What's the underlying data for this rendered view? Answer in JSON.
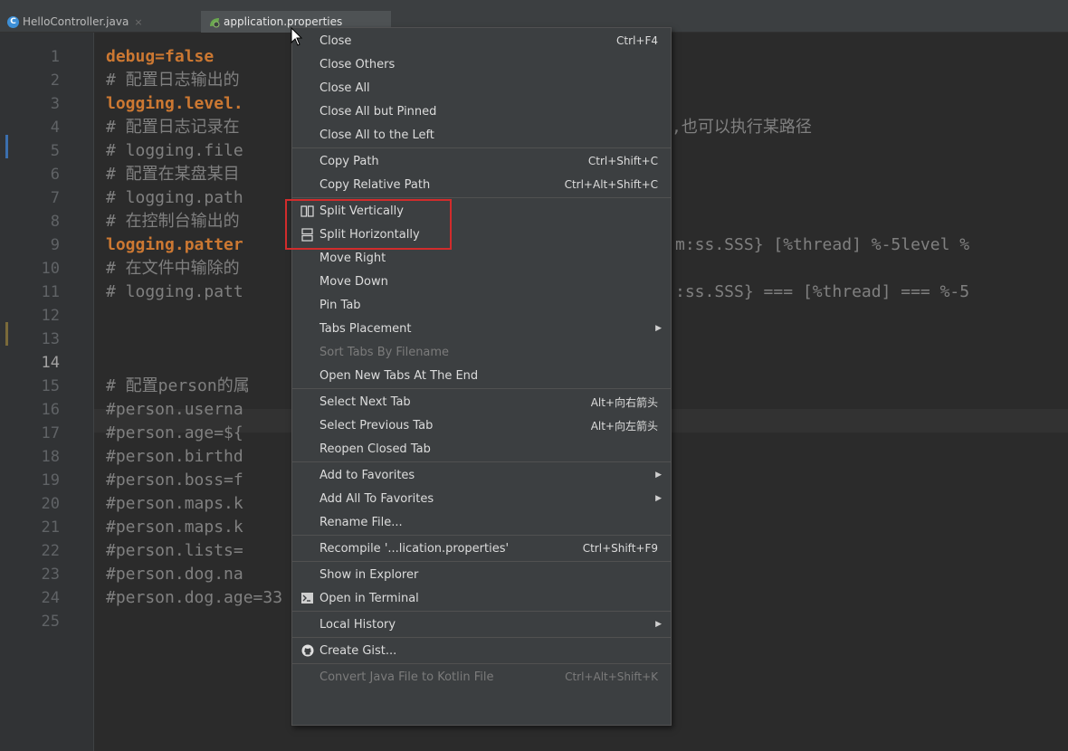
{
  "tabs": [
    {
      "name": "HelloController.java",
      "icon": "java-class-icon",
      "icon_letter": "C",
      "active": false
    },
    {
      "name": "application.properties",
      "icon": "spring-leaf-icon",
      "active": true
    }
  ],
  "editor": {
    "current_line": 14,
    "lines": [
      {
        "n": "1",
        "type": "key",
        "text": "debug=false"
      },
      {
        "n": "2",
        "type": "comment",
        "text": "# 配置日志输出的"
      },
      {
        "n": "3",
        "type": "key",
        "text": "logging.level."
      },
      {
        "n": "4",
        "type": "comment",
        "text": "# 配置日志记录在",
        "far": ",也可以执行某路径",
        "far_type": "comment"
      },
      {
        "n": "5",
        "type": "comment",
        "text": "# logging.file"
      },
      {
        "n": "6",
        "type": "comment",
        "text": "# 配置在某盘某目"
      },
      {
        "n": "7",
        "type": "comment",
        "text": "# logging.path"
      },
      {
        "n": "8",
        "type": "comment",
        "text": "# 在控制台输出的"
      },
      {
        "n": "9",
        "type": "key",
        "text": "logging.patter",
        "far": "m:ss.SSS} [%thread] %-5level %",
        "far_type": "comment"
      },
      {
        "n": "10",
        "type": "comment",
        "text": "# 在文件中输除的"
      },
      {
        "n": "11",
        "type": "comment",
        "text": "# logging.patt",
        "far": ":ss.SSS} === [%thread] === %-5",
        "far_type": "comment"
      },
      {
        "n": "12",
        "type": "comment",
        "text": ""
      },
      {
        "n": "13",
        "type": "comment",
        "text": ""
      },
      {
        "n": "14",
        "type": "comment",
        "text": ""
      },
      {
        "n": "15",
        "type": "comment",
        "text": "# 配置person的属"
      },
      {
        "n": "16",
        "type": "comment",
        "text": "#person.userna"
      },
      {
        "n": "17",
        "type": "comment",
        "text": "#person.age=${"
      },
      {
        "n": "18",
        "type": "comment",
        "text": "#person.birthd"
      },
      {
        "n": "19",
        "type": "comment",
        "text": "#person.boss=f"
      },
      {
        "n": "20",
        "type": "comment",
        "text": "#person.maps.k"
      },
      {
        "n": "21",
        "type": "comment",
        "text": "#person.maps.k"
      },
      {
        "n": "22",
        "type": "comment",
        "text": "#person.lists="
      },
      {
        "n": "23",
        "type": "comment",
        "text": "#person.dog.na"
      },
      {
        "n": "24",
        "type": "comment",
        "text": "#person.dog.age=33"
      },
      {
        "n": "25",
        "type": "comment",
        "text": ""
      }
    ]
  },
  "menu": {
    "items": [
      {
        "label": "Close",
        "shortcut": "Ctrl+F4"
      },
      {
        "label": "Close Others"
      },
      {
        "label": "Close All"
      },
      {
        "label": "Close All but Pinned"
      },
      {
        "label": "Close All to the Left",
        "sep_after": true
      },
      {
        "label": "Copy Path",
        "shortcut": "Ctrl+Shift+C"
      },
      {
        "label": "Copy Relative Path",
        "shortcut": "Ctrl+Alt+Shift+C",
        "sep_after": true
      },
      {
        "label": "Split Vertically",
        "icon": "split-vertically-icon"
      },
      {
        "label": "Split Horizontally",
        "icon": "split-horizontally-icon"
      },
      {
        "label": "Move Right"
      },
      {
        "label": "Move Down"
      },
      {
        "label": "Pin Tab"
      },
      {
        "label": "Tabs Placement",
        "submenu": true
      },
      {
        "label": "Sort Tabs By Filename",
        "disabled": true
      },
      {
        "label": "Open New Tabs At The End",
        "sep_after": true
      },
      {
        "label": "Select Next Tab",
        "shortcut": "Alt+向右箭头"
      },
      {
        "label": "Select Previous Tab",
        "shortcut": "Alt+向左箭头"
      },
      {
        "label": "Reopen Closed Tab",
        "sep_after": true
      },
      {
        "label": "Add to Favorites",
        "submenu": true
      },
      {
        "label": "Add All To Favorites",
        "submenu": true
      },
      {
        "label": "Rename File...",
        "sep_after": true
      },
      {
        "label": "Recompile '...lication.properties'",
        "shortcut": "Ctrl+Shift+F9",
        "sep_after": true
      },
      {
        "label": "Show in Explorer"
      },
      {
        "label": "Open in Terminal",
        "icon": "terminal-icon",
        "sep_after": true
      },
      {
        "label": "Local History",
        "submenu": true,
        "sep_after": true
      },
      {
        "label": "Create Gist...",
        "icon": "github-icon",
        "sep_after": true
      },
      {
        "label": "Convert Java File to Kotlin File",
        "shortcut": "Ctrl+Alt+Shift+K",
        "disabled": true
      }
    ]
  },
  "colors": {
    "background": "#2b2b2b",
    "gutter": "#313335",
    "menu_bg": "#3c3f41",
    "keyword": "#cc7832",
    "comment": "#808080",
    "highlight_box": "#d22c2c"
  }
}
